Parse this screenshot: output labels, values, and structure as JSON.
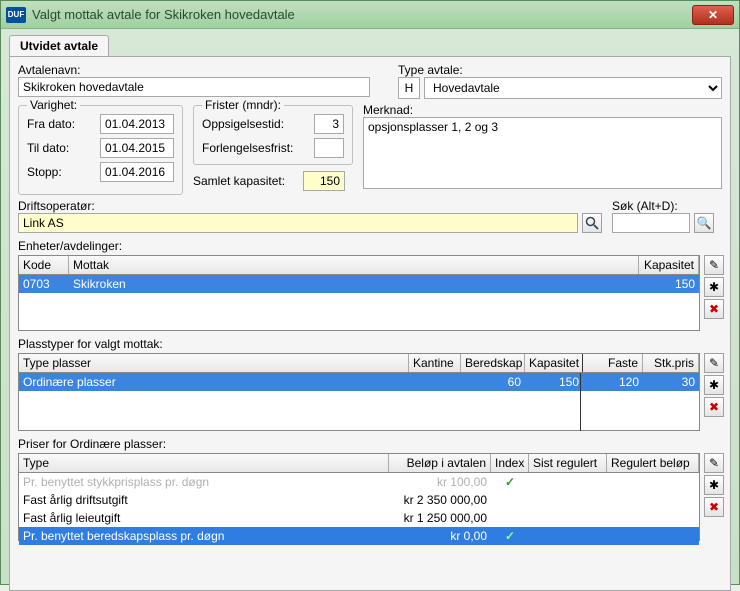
{
  "window": {
    "logo": "DUF",
    "title": "Valgt mottak avtale for Skikroken hovedavtale"
  },
  "tab": {
    "label": "Utvidet avtale"
  },
  "avtalenavn": {
    "label": "Avtalenavn:",
    "value": "Skikroken hovedavtale"
  },
  "typeavtale": {
    "label": "Type avtale:",
    "code": "H",
    "value": "Hovedavtale"
  },
  "varighet": {
    "legend": "Varighet:",
    "fra": {
      "label": "Fra dato:",
      "value": "01.04.2013"
    },
    "til": {
      "label": "Til dato:",
      "value": "01.04.2015"
    },
    "stopp": {
      "label": "Stopp:",
      "value": "01.04.2016"
    }
  },
  "frister": {
    "legend": "Frister (mndr):",
    "oppsigelse": {
      "label": "Oppsigelsestid:",
      "value": "3"
    },
    "forlengelse": {
      "label": "Forlengelsesfrist:",
      "value": ""
    }
  },
  "samlet": {
    "label": "Samlet kapasitet:",
    "value": "150"
  },
  "merknad": {
    "label": "Merknad:",
    "value": "opsjonsplasser 1, 2 og 3"
  },
  "operator": {
    "label": "Driftsoperatør:",
    "value": "Link AS"
  },
  "sok": {
    "label": "Søk (Alt+D):",
    "value": ""
  },
  "enheter": {
    "label": "Enheter/avdelinger:",
    "headers": {
      "kode": "Kode",
      "mottak": "Mottak",
      "kapasitet": "Kapasitet"
    },
    "rows": [
      {
        "kode": "0703",
        "mottak": "Skikroken",
        "kapasitet": "150"
      }
    ]
  },
  "plasstyper": {
    "label": "Plasstyper for valgt mottak:",
    "headers": {
      "type": "Type plasser",
      "kantine": "Kantine",
      "beredskap": "Beredskap",
      "kapasitet": "Kapasitet",
      "faste": "Faste",
      "stkpris": "Stk.pris"
    },
    "rows": [
      {
        "type": "Ordinære plasser",
        "kantine": "",
        "beredskap": "60",
        "kapasitet": "150",
        "faste": "120",
        "stkpris": "30"
      }
    ]
  },
  "priser": {
    "label": "Priser for Ordinære plasser:",
    "headers": {
      "type": "Type",
      "belop": "Beløp i avtalen",
      "index": "Index",
      "sistreg": "Sist regulert",
      "regbel": "Regulert beløp"
    },
    "rows": [
      {
        "type": "Pr. benyttet stykkprisplass pr. døgn",
        "belop": "kr 100,00",
        "index": "✓",
        "dim": true
      },
      {
        "type": "Fast årlig driftsutgift",
        "belop": "kr 2 350 000,00",
        "index": ""
      },
      {
        "type": "Fast årlig leieutgift",
        "belop": "kr 1 250 000,00",
        "index": ""
      },
      {
        "type": "Pr. benyttet beredskapsplass pr. døgn",
        "belop": "kr 0,00",
        "index": "✓",
        "sel": true
      }
    ]
  }
}
